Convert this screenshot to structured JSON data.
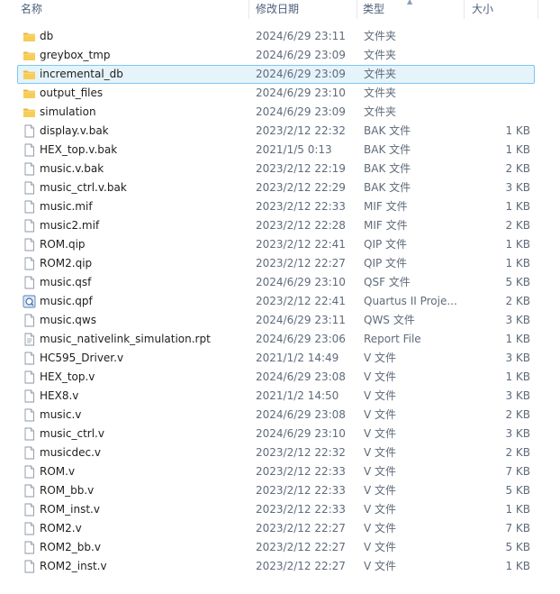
{
  "columns": {
    "name": "名称",
    "date": "修改日期",
    "type": "类型",
    "size": "大小"
  },
  "files": [
    {
      "name": "db",
      "date": "2024/6/29 23:11",
      "type": "文件夹",
      "size": "",
      "icon": "folder-icon"
    },
    {
      "name": "greybox_tmp",
      "date": "2024/6/29 23:09",
      "type": "文件夹",
      "size": "",
      "icon": "folder-icon"
    },
    {
      "name": "incremental_db",
      "date": "2024/6/29 23:09",
      "type": "文件夹",
      "size": "",
      "icon": "folder-icon",
      "selected": true
    },
    {
      "name": "output_files",
      "date": "2024/6/29 23:10",
      "type": "文件夹",
      "size": "",
      "icon": "folder-icon"
    },
    {
      "name": "simulation",
      "date": "2024/6/29 23:09",
      "type": "文件夹",
      "size": "",
      "icon": "folder-icon"
    },
    {
      "name": "display.v.bak",
      "date": "2023/2/12 22:32",
      "type": "BAK 文件",
      "size": "1 KB",
      "icon": "file-icon"
    },
    {
      "name": "HEX_top.v.bak",
      "date": "2021/1/5 0:13",
      "type": "BAK 文件",
      "size": "1 KB",
      "icon": "file-icon"
    },
    {
      "name": "music.v.bak",
      "date": "2023/2/12 22:19",
      "type": "BAK 文件",
      "size": "2 KB",
      "icon": "file-icon"
    },
    {
      "name": "music_ctrl.v.bak",
      "date": "2023/2/12 22:29",
      "type": "BAK 文件",
      "size": "3 KB",
      "icon": "file-icon"
    },
    {
      "name": "music.mif",
      "date": "2023/2/12 22:33",
      "type": "MIF 文件",
      "size": "1 KB",
      "icon": "file-icon"
    },
    {
      "name": "music2.mif",
      "date": "2023/2/12 22:28",
      "type": "MIF 文件",
      "size": "2 KB",
      "icon": "file-icon"
    },
    {
      "name": "ROM.qip",
      "date": "2023/2/12 22:41",
      "type": "QIP 文件",
      "size": "1 KB",
      "icon": "file-icon"
    },
    {
      "name": "ROM2.qip",
      "date": "2023/2/12 22:27",
      "type": "QIP 文件",
      "size": "1 KB",
      "icon": "file-icon"
    },
    {
      "name": "music.qsf",
      "date": "2024/6/29 23:10",
      "type": "QSF 文件",
      "size": "5 KB",
      "icon": "file-icon"
    },
    {
      "name": "music.qpf",
      "date": "2023/2/12 22:41",
      "type": "Quartus II Proje...",
      "size": "2 KB",
      "icon": "quartus-project-icon"
    },
    {
      "name": "music.qws",
      "date": "2024/6/29 23:11",
      "type": "QWS 文件",
      "size": "3 KB",
      "icon": "file-icon"
    },
    {
      "name": "music_nativelink_simulation.rpt",
      "date": "2024/6/29 23:06",
      "type": "Report File",
      "size": "1 KB",
      "icon": "text-file-icon"
    },
    {
      "name": "HC595_Driver.v",
      "date": "2021/1/2 14:49",
      "type": "V 文件",
      "size": "3 KB",
      "icon": "file-icon"
    },
    {
      "name": "HEX_top.v",
      "date": "2024/6/29 23:08",
      "type": "V 文件",
      "size": "1 KB",
      "icon": "file-icon"
    },
    {
      "name": "HEX8.v",
      "date": "2021/1/2 14:50",
      "type": "V 文件",
      "size": "3 KB",
      "icon": "file-icon"
    },
    {
      "name": "music.v",
      "date": "2024/6/29 23:08",
      "type": "V 文件",
      "size": "2 KB",
      "icon": "file-icon"
    },
    {
      "name": "music_ctrl.v",
      "date": "2024/6/29 23:10",
      "type": "V 文件",
      "size": "3 KB",
      "icon": "file-icon"
    },
    {
      "name": "musicdec.v",
      "date": "2023/2/12 22:32",
      "type": "V 文件",
      "size": "2 KB",
      "icon": "file-icon"
    },
    {
      "name": "ROM.v",
      "date": "2023/2/12 22:33",
      "type": "V 文件",
      "size": "7 KB",
      "icon": "file-icon"
    },
    {
      "name": "ROM_bb.v",
      "date": "2023/2/12 22:33",
      "type": "V 文件",
      "size": "5 KB",
      "icon": "file-icon"
    },
    {
      "name": "ROM_inst.v",
      "date": "2023/2/12 22:33",
      "type": "V 文件",
      "size": "1 KB",
      "icon": "file-icon"
    },
    {
      "name": "ROM2.v",
      "date": "2023/2/12 22:27",
      "type": "V 文件",
      "size": "7 KB",
      "icon": "file-icon"
    },
    {
      "name": "ROM2_bb.v",
      "date": "2023/2/12 22:27",
      "type": "V 文件",
      "size": "5 KB",
      "icon": "file-icon"
    },
    {
      "name": "ROM2_inst.v",
      "date": "2023/2/12 22:27",
      "type": "V 文件",
      "size": "1 KB",
      "icon": "file-icon"
    }
  ],
  "colors": {
    "selection_bg": "#e5f3fb",
    "selection_border": "#7ec8ee",
    "folder": "#f5c74a"
  }
}
